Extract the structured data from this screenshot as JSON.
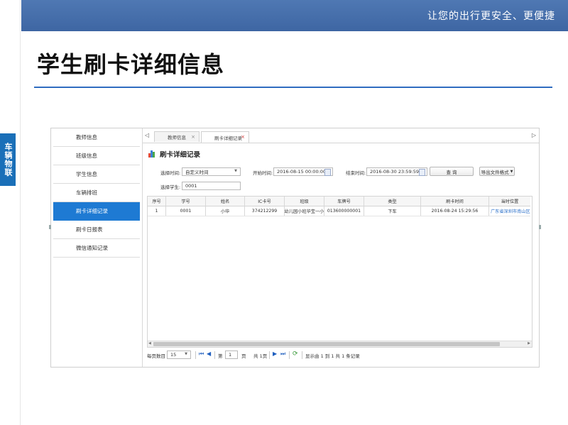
{
  "slogan": "让您的出行更安全、更便捷",
  "side_tab": "车辆物联",
  "page_title": "学生刷卡详细信息",
  "nav": {
    "items": [
      {
        "label": "教师信息",
        "active": false
      },
      {
        "label": "班级信息",
        "active": false
      },
      {
        "label": "学生信息",
        "active": false
      },
      {
        "label": "车辆排班",
        "active": false
      },
      {
        "label": "刷卡详细记录",
        "active": true
      },
      {
        "label": "刷卡日报表",
        "active": false
      },
      {
        "label": "微信通知记录",
        "active": false
      }
    ]
  },
  "tabs": {
    "left_arrow": "◁",
    "right_arrow": "▷",
    "items": [
      {
        "label": "教师信息",
        "close": "×"
      },
      {
        "label": "刷卡详细记录",
        "close": "×"
      }
    ]
  },
  "section_title": "刷卡详细记录",
  "filters": {
    "time_label": "选择时间:",
    "time_value": "自定义时间",
    "start_label": "开始时间:",
    "start_value": "2016-08-15 00:00:00",
    "end_label": "结束时间:",
    "end_value": "2016-08-30 23:59:59",
    "query_button": "查 询",
    "export_button": "导出文件格式",
    "student_label": "选择学生:",
    "student_value": "0001"
  },
  "table": {
    "headers": [
      "序号",
      "学号",
      "姓名",
      "IC卡号",
      "班级",
      "车牌号",
      "类型",
      "刷卡时间",
      "当时位置"
    ],
    "rows": [
      [
        "1",
        "0001",
        "小华",
        "374212299",
        "幼儿园小班华宝一小",
        "013600000001",
        "下车",
        "2016-08-24 15:29:56",
        "广东省深圳市南山区"
      ]
    ]
  },
  "pager": {
    "per_page_label": "每页数目",
    "per_page_value": "15",
    "page_prefix": "第",
    "page_value": "1",
    "page_suffix": "页",
    "total_pages": "共 1页",
    "summary": "显示由 1 到 1 共 1 条记录"
  },
  "colors": {
    "header_bar": "#4f78b3",
    "accent_blue": "#1e7ad3",
    "title_rule": "#2f6cc0",
    "side_tab": "#1a6fb8"
  }
}
